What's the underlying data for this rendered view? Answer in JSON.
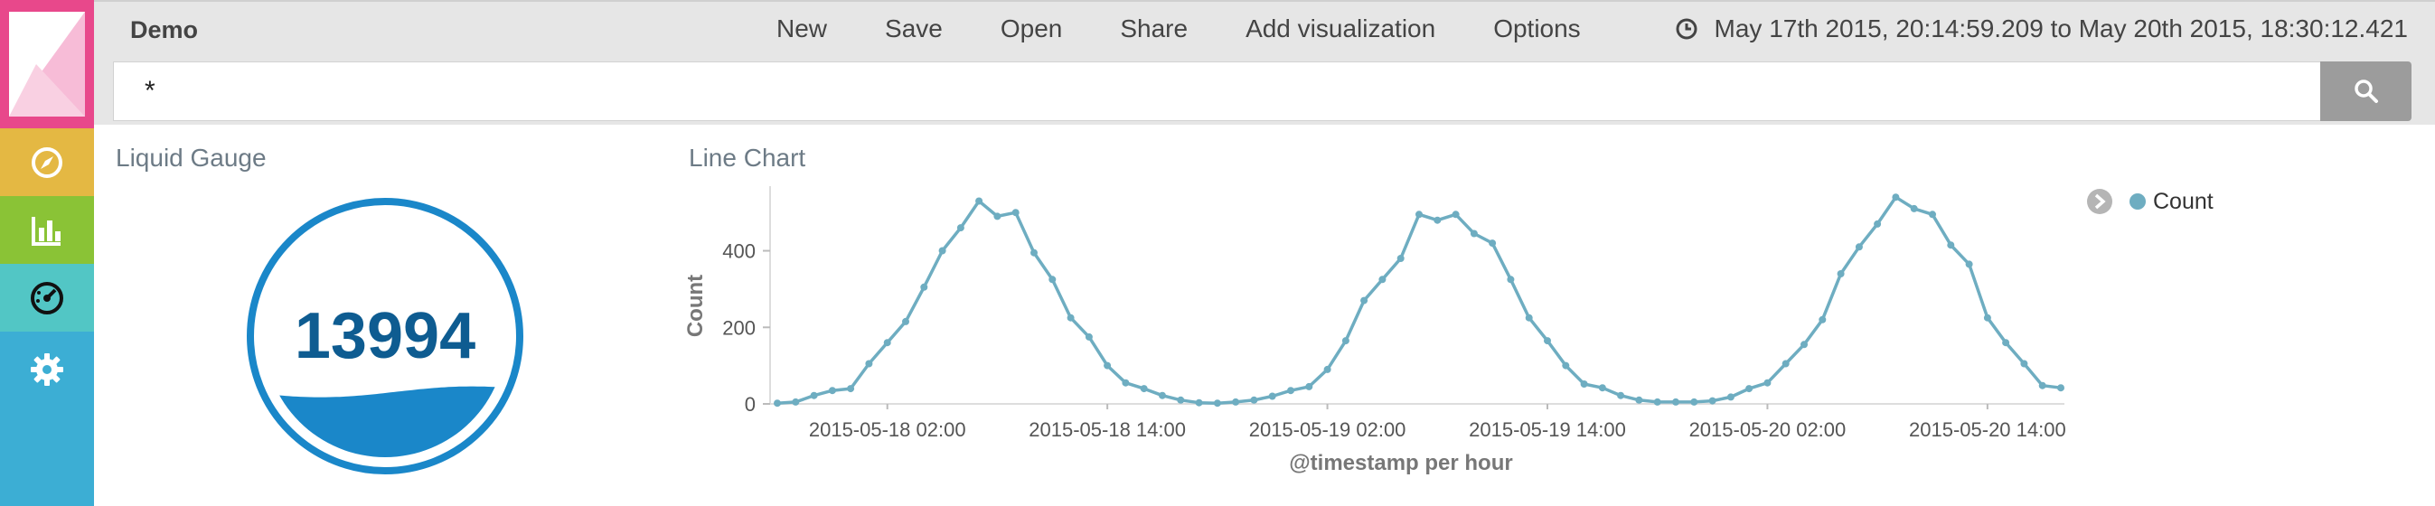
{
  "app": {
    "title": "Demo"
  },
  "nav": {
    "logo_icon": "kibana-logo-icon",
    "items": [
      {
        "name": "discover",
        "icon": "compass-icon",
        "color": "#e4b843"
      },
      {
        "name": "visualize",
        "icon": "bar-chart-icon",
        "color": "#8ac336"
      },
      {
        "name": "dashboard",
        "icon": "gauge-icon",
        "color": "#52c6c5"
      },
      {
        "name": "settings",
        "icon": "gear-icon",
        "color": "#3caed4"
      }
    ]
  },
  "menu": {
    "new": "New",
    "save": "Save",
    "open": "Open",
    "share": "Share",
    "add_visualization": "Add visualization",
    "options": "Options"
  },
  "time_range": {
    "icon": "clock-icon",
    "label": "May 17th 2015, 20:14:59.209 to May 20th 2015, 18:30:12.421"
  },
  "search": {
    "value": "*",
    "button_icon": "search-icon"
  },
  "panels": {
    "gauge": {
      "title": "Liquid Gauge",
      "value": "13994",
      "fill_level": 0.27,
      "color": "#1a87c9"
    },
    "line": {
      "title": "Line Chart"
    }
  },
  "chart_data": {
    "type": "line",
    "xlabel": "@timestamp per hour",
    "ylabel": "Count",
    "ylim": [
      0,
      550
    ],
    "yticks": [
      0,
      200,
      400
    ],
    "xlim": [
      "2015-05-17 20:00",
      "2015-05-20 18:00"
    ],
    "x_tick_labels": [
      "2015-05-18 02:00",
      "2015-05-18 14:00",
      "2015-05-19 02:00",
      "2015-05-19 14:00",
      "2015-05-20 02:00",
      "2015-05-20 14:00"
    ],
    "grid": false,
    "legend_position": "top-right",
    "series": [
      {
        "name": "Count",
        "color": "#6eadc1",
        "x": [
          "2015-05-17 20:00",
          "2015-05-17 21:00",
          "2015-05-17 22:00",
          "2015-05-17 23:00",
          "2015-05-18 00:00",
          "2015-05-18 01:00",
          "2015-05-18 02:00",
          "2015-05-18 03:00",
          "2015-05-18 04:00",
          "2015-05-18 05:00",
          "2015-05-18 06:00",
          "2015-05-18 07:00",
          "2015-05-18 08:00",
          "2015-05-18 09:00",
          "2015-05-18 10:00",
          "2015-05-18 11:00",
          "2015-05-18 12:00",
          "2015-05-18 13:00",
          "2015-05-18 14:00",
          "2015-05-18 15:00",
          "2015-05-18 16:00",
          "2015-05-18 17:00",
          "2015-05-18 18:00",
          "2015-05-18 19:00",
          "2015-05-18 20:00",
          "2015-05-18 21:00",
          "2015-05-18 22:00",
          "2015-05-18 23:00",
          "2015-05-19 00:00",
          "2015-05-19 01:00",
          "2015-05-19 02:00",
          "2015-05-19 03:00",
          "2015-05-19 04:00",
          "2015-05-19 05:00",
          "2015-05-19 06:00",
          "2015-05-19 07:00",
          "2015-05-19 08:00",
          "2015-05-19 09:00",
          "2015-05-19 10:00",
          "2015-05-19 11:00",
          "2015-05-19 12:00",
          "2015-05-19 13:00",
          "2015-05-19 14:00",
          "2015-05-19 15:00",
          "2015-05-19 16:00",
          "2015-05-19 17:00",
          "2015-05-19 18:00",
          "2015-05-19 19:00",
          "2015-05-19 20:00",
          "2015-05-19 21:00",
          "2015-05-19 22:00",
          "2015-05-19 23:00",
          "2015-05-20 00:00",
          "2015-05-20 01:00",
          "2015-05-20 02:00",
          "2015-05-20 03:00",
          "2015-05-20 04:00",
          "2015-05-20 05:00",
          "2015-05-20 06:00",
          "2015-05-20 07:00",
          "2015-05-20 08:00",
          "2015-05-20 09:00",
          "2015-05-20 10:00",
          "2015-05-20 11:00",
          "2015-05-20 12:00",
          "2015-05-20 13:00",
          "2015-05-20 14:00",
          "2015-05-20 15:00",
          "2015-05-20 16:00",
          "2015-05-20 17:00",
          "2015-05-20 18:00"
        ],
        "values": [
          2,
          5,
          22,
          35,
          40,
          105,
          160,
          215,
          305,
          400,
          460,
          530,
          490,
          500,
          395,
          325,
          225,
          175,
          100,
          55,
          40,
          22,
          10,
          3,
          2,
          5,
          10,
          20,
          35,
          45,
          90,
          165,
          270,
          325,
          380,
          495,
          480,
          495,
          445,
          420,
          325,
          225,
          165,
          100,
          52,
          42,
          22,
          10,
          5,
          5,
          5,
          8,
          18,
          40,
          55,
          105,
          155,
          220,
          340,
          410,
          470,
          540,
          510,
          495,
          415,
          365,
          225,
          160,
          105,
          48,
          42
        ]
      }
    ]
  }
}
